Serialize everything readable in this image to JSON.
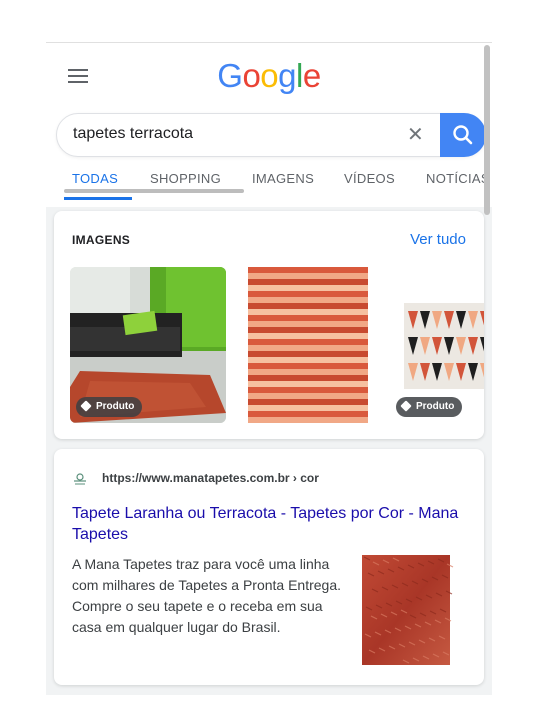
{
  "logo": {
    "text": "Google",
    "letters": [
      "G",
      "o",
      "o",
      "g",
      "l",
      "e"
    ],
    "colors": [
      "#4285f4",
      "#ea4335",
      "#fbbc05",
      "#4285f4",
      "#34a853",
      "#ea4335"
    ]
  },
  "search": {
    "query": "tapetes terracota",
    "clear_symbol": "✕"
  },
  "tabs": [
    {
      "label": "TODAS",
      "active": true
    },
    {
      "label": "SHOPPING",
      "active": false
    },
    {
      "label": "IMAGENS",
      "active": false
    },
    {
      "label": "VÍDEOS",
      "active": false
    },
    {
      "label": "NOTÍCIAS",
      "active": false
    }
  ],
  "images": {
    "heading": "IMAGENS",
    "see_all": "Ver tudo",
    "thumbnails": [
      {
        "description": "rug-with-sofa",
        "badge": "Produto"
      },
      {
        "description": "striped-rug",
        "badge": ""
      },
      {
        "description": "geometric-rug",
        "badge": "Produto"
      }
    ]
  },
  "result": {
    "url": "https://www.manatapetes.com.br › cor",
    "title": "Tapete Laranha ou Terracota - Tapetes por Cor - Mana Tapetes",
    "snippet": "A Mana Tapetes traz para você uma linha com milhares de Tapetes a Pronta Entrega. Compre o seu tapete e o receba em sua casa em qualquer lugar do Brasil."
  },
  "colors": {
    "accent": "#1a73e8",
    "search_button": "#4285f4",
    "link": "#1a0dab",
    "terracotta": "#b5442c"
  },
  "icons": [
    "menu-icon",
    "clear-icon",
    "search-icon",
    "tag-icon",
    "site-favicon"
  ]
}
